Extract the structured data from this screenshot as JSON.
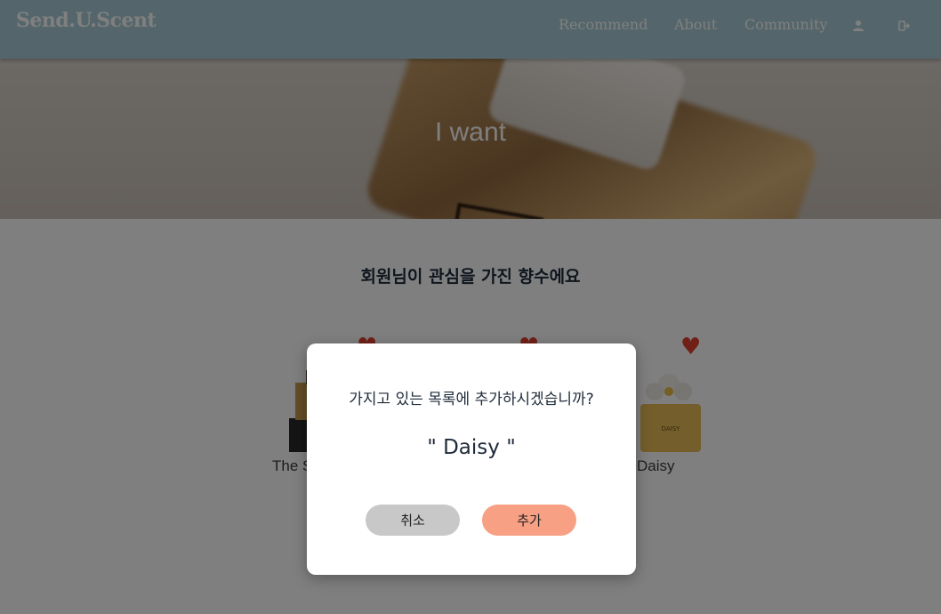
{
  "header": {
    "brand": "Send.U.Scent",
    "links": [
      "Recommend",
      "About",
      "Community"
    ],
    "icons": [
      "user-icon",
      "logout-icon"
    ],
    "background": "#a9cdd6"
  },
  "hero": {
    "title": "I want"
  },
  "main": {
    "title": "회원님이 관심을 가진 향수에요",
    "products": [
      {
        "name": "The S",
        "liked": true
      },
      {
        "name": "",
        "liked": true
      },
      {
        "name": "Daisy",
        "liked": true
      }
    ]
  },
  "modal": {
    "message": "가지고 있는 목록에 추가하시겠습니까?",
    "item_name": "\" Daisy \"",
    "cancel_label": "취소",
    "add_label": "추가",
    "cancel_color": "#c8c8c8",
    "add_color": "#f7a083"
  },
  "accent": {
    "heart": "#e2402e"
  }
}
